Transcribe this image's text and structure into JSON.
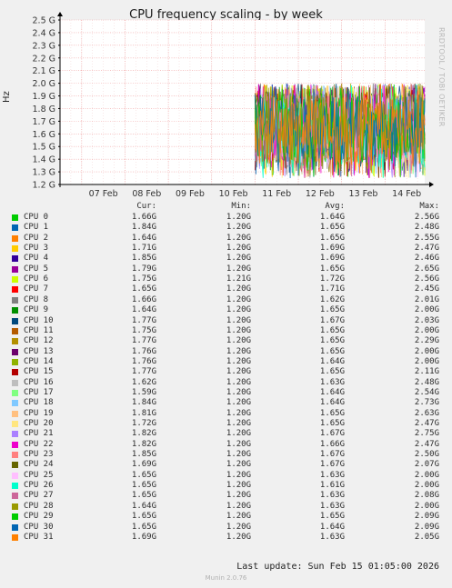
{
  "chart_data": {
    "type": "line",
    "title": "CPU frequency scaling - by week",
    "ylabel": "Hz",
    "y_ticks": [
      "1.2 G",
      "1.3 G",
      "1.4 G",
      "1.5 G",
      "1.6 G",
      "1.7 G",
      "1.8 G",
      "1.9 G",
      "2.0 G",
      "2.1 G",
      "2.2 G",
      "2.3 G",
      "2.4 G",
      "2.5 G"
    ],
    "y_tick_values": [
      1.2,
      1.3,
      1.4,
      1.5,
      1.6,
      1.7,
      1.8,
      1.9,
      2.0,
      2.1,
      2.2,
      2.3,
      2.4,
      2.5
    ],
    "ylim": [
      1.2,
      2.5
    ],
    "x_ticks": [
      "07 Feb",
      "08 Feb",
      "09 Feb",
      "10 Feb",
      "11 Feb",
      "12 Feb",
      "13 Feb",
      "14 Feb"
    ],
    "xlim": [
      "2026-02-06 12:00",
      "2026-02-14 22:00"
    ],
    "data_start": "2026-02-11 00:00",
    "grid": true,
    "watermark": "RRDTOOL / TOBI OETIKER",
    "columns": [
      "Cur:",
      "Min:",
      "Avg:",
      "Max:"
    ],
    "series": [
      {
        "name": "CPU 0",
        "color": "#00cc00",
        "cur": "1.66G",
        "min": "1.20G",
        "avg": "1.64G",
        "max": "2.56G"
      },
      {
        "name": "CPU 1",
        "color": "#0066b3",
        "cur": "1.84G",
        "min": "1.20G",
        "avg": "1.65G",
        "max": "2.48G"
      },
      {
        "name": "CPU 2",
        "color": "#ff8000",
        "cur": "1.64G",
        "min": "1.20G",
        "avg": "1.65G",
        "max": "2.55G"
      },
      {
        "name": "CPU 3",
        "color": "#ffcc00",
        "cur": "1.71G",
        "min": "1.20G",
        "avg": "1.69G",
        "max": "2.47G"
      },
      {
        "name": "CPU 4",
        "color": "#330099",
        "cur": "1.85G",
        "min": "1.20G",
        "avg": "1.69G",
        "max": "2.46G"
      },
      {
        "name": "CPU 5",
        "color": "#990099",
        "cur": "1.79G",
        "min": "1.20G",
        "avg": "1.65G",
        "max": "2.65G"
      },
      {
        "name": "CPU 6",
        "color": "#ccff00",
        "cur": "1.75G",
        "min": "1.21G",
        "avg": "1.72G",
        "max": "2.56G"
      },
      {
        "name": "CPU 7",
        "color": "#ff0000",
        "cur": "1.65G",
        "min": "1.20G",
        "avg": "1.71G",
        "max": "2.45G"
      },
      {
        "name": "CPU 8",
        "color": "#808080",
        "cur": "1.66G",
        "min": "1.20G",
        "avg": "1.62G",
        "max": "2.01G"
      },
      {
        "name": "CPU 9",
        "color": "#008f00",
        "cur": "1.64G",
        "min": "1.20G",
        "avg": "1.65G",
        "max": "2.00G"
      },
      {
        "name": "CPU 10",
        "color": "#00487d",
        "cur": "1.77G",
        "min": "1.20G",
        "avg": "1.67G",
        "max": "2.03G"
      },
      {
        "name": "CPU 11",
        "color": "#b35a00",
        "cur": "1.75G",
        "min": "1.20G",
        "avg": "1.65G",
        "max": "2.00G"
      },
      {
        "name": "CPU 12",
        "color": "#b38f00",
        "cur": "1.77G",
        "min": "1.20G",
        "avg": "1.65G",
        "max": "2.29G"
      },
      {
        "name": "CPU 13",
        "color": "#6b006b",
        "cur": "1.76G",
        "min": "1.20G",
        "avg": "1.65G",
        "max": "2.00G"
      },
      {
        "name": "CPU 14",
        "color": "#8fb300",
        "cur": "1.76G",
        "min": "1.20G",
        "avg": "1.64G",
        "max": "2.00G"
      },
      {
        "name": "CPU 15",
        "color": "#b30000",
        "cur": "1.77G",
        "min": "1.20G",
        "avg": "1.65G",
        "max": "2.11G"
      },
      {
        "name": "CPU 16",
        "color": "#bebebe",
        "cur": "1.62G",
        "min": "1.20G",
        "avg": "1.63G",
        "max": "2.48G"
      },
      {
        "name": "CPU 17",
        "color": "#80ff80",
        "cur": "1.59G",
        "min": "1.20G",
        "avg": "1.64G",
        "max": "2.54G"
      },
      {
        "name": "CPU 18",
        "color": "#80c9ff",
        "cur": "1.84G",
        "min": "1.20G",
        "avg": "1.64G",
        "max": "2.73G"
      },
      {
        "name": "CPU 19",
        "color": "#ffc080",
        "cur": "1.81G",
        "min": "1.20G",
        "avg": "1.65G",
        "max": "2.63G"
      },
      {
        "name": "CPU 20",
        "color": "#ffe680",
        "cur": "1.72G",
        "min": "1.20G",
        "avg": "1.65G",
        "max": "2.47G"
      },
      {
        "name": "CPU 21",
        "color": "#aa80ff",
        "cur": "1.82G",
        "min": "1.20G",
        "avg": "1.67G",
        "max": "2.75G"
      },
      {
        "name": "CPU 22",
        "color": "#ee00cc",
        "cur": "1.82G",
        "min": "1.20G",
        "avg": "1.66G",
        "max": "2.47G"
      },
      {
        "name": "CPU 23",
        "color": "#ff8080",
        "cur": "1.85G",
        "min": "1.20G",
        "avg": "1.67G",
        "max": "2.50G"
      },
      {
        "name": "CPU 24",
        "color": "#666600",
        "cur": "1.69G",
        "min": "1.20G",
        "avg": "1.67G",
        "max": "2.07G"
      },
      {
        "name": "CPU 25",
        "color": "#ffbfff",
        "cur": "1.65G",
        "min": "1.20G",
        "avg": "1.63G",
        "max": "2.00G"
      },
      {
        "name": "CPU 26",
        "color": "#00ffcc",
        "cur": "1.65G",
        "min": "1.20G",
        "avg": "1.61G",
        "max": "2.00G"
      },
      {
        "name": "CPU 27",
        "color": "#cc6699",
        "cur": "1.65G",
        "min": "1.20G",
        "avg": "1.63G",
        "max": "2.08G"
      },
      {
        "name": "CPU 28",
        "color": "#999900",
        "cur": "1.64G",
        "min": "1.20G",
        "avg": "1.63G",
        "max": "2.00G"
      },
      {
        "name": "CPU 29",
        "color": "#00cc00",
        "cur": "1.65G",
        "min": "1.20G",
        "avg": "1.65G",
        "max": "2.09G"
      },
      {
        "name": "CPU 30",
        "color": "#0066b3",
        "cur": "1.65G",
        "min": "1.20G",
        "avg": "1.64G",
        "max": "2.09G"
      },
      {
        "name": "CPU 31",
        "color": "#ff8000",
        "cur": "1.69G",
        "min": "1.20G",
        "avg": "1.63G",
        "max": "2.05G"
      }
    ]
  },
  "footer": {
    "last_update": "Last update: Sun Feb 15 01:05:00 2026",
    "munin": "Munin 2.0.76"
  }
}
